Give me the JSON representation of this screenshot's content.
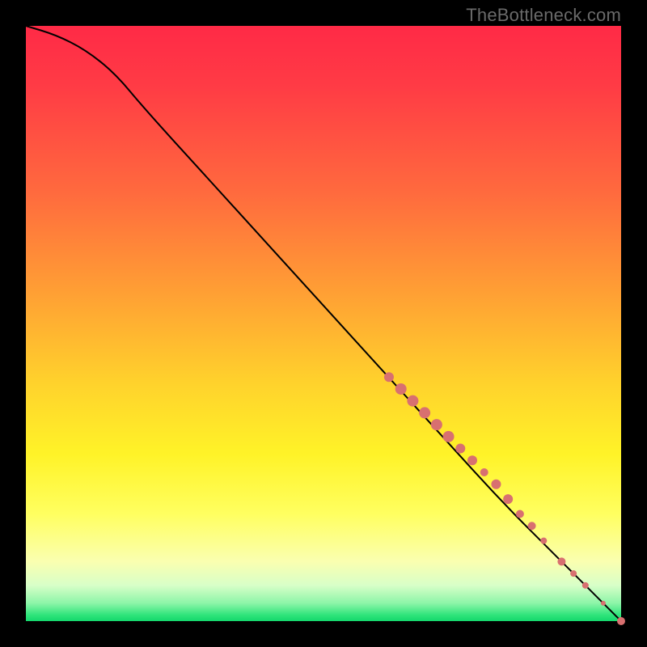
{
  "watermark": "TheBottleneck.com",
  "chart_data": {
    "type": "line",
    "title": "",
    "xlabel": "",
    "ylabel": "",
    "xlim": [
      0,
      100
    ],
    "ylim": [
      0,
      100
    ],
    "curve": [
      {
        "x": 0,
        "y": 100
      },
      {
        "x": 5,
        "y": 98.5
      },
      {
        "x": 10,
        "y": 96
      },
      {
        "x": 15,
        "y": 92
      },
      {
        "x": 20,
        "y": 86
      },
      {
        "x": 30,
        "y": 75
      },
      {
        "x": 40,
        "y": 64
      },
      {
        "x": 50,
        "y": 53
      },
      {
        "x": 60,
        "y": 42
      },
      {
        "x": 70,
        "y": 31
      },
      {
        "x": 80,
        "y": 20
      },
      {
        "x": 90,
        "y": 10
      },
      {
        "x": 100,
        "y": 0
      }
    ],
    "points": [
      {
        "x": 61,
        "y": 41,
        "r": 6
      },
      {
        "x": 63,
        "y": 39,
        "r": 7
      },
      {
        "x": 65,
        "y": 37,
        "r": 7
      },
      {
        "x": 67,
        "y": 35,
        "r": 7
      },
      {
        "x": 69,
        "y": 33,
        "r": 7
      },
      {
        "x": 71,
        "y": 31,
        "r": 7
      },
      {
        "x": 73,
        "y": 29,
        "r": 6
      },
      {
        "x": 75,
        "y": 27,
        "r": 6
      },
      {
        "x": 77,
        "y": 25,
        "r": 5
      },
      {
        "x": 79,
        "y": 23,
        "r": 6
      },
      {
        "x": 81,
        "y": 20.5,
        "r": 6
      },
      {
        "x": 83,
        "y": 18,
        "r": 5
      },
      {
        "x": 85,
        "y": 16,
        "r": 5
      },
      {
        "x": 87,
        "y": 13.5,
        "r": 4
      },
      {
        "x": 90,
        "y": 10,
        "r": 5
      },
      {
        "x": 92,
        "y": 8,
        "r": 4
      },
      {
        "x": 94,
        "y": 6,
        "r": 4
      },
      {
        "x": 97,
        "y": 3,
        "r": 3
      },
      {
        "x": 100,
        "y": 0,
        "r": 5
      }
    ]
  }
}
